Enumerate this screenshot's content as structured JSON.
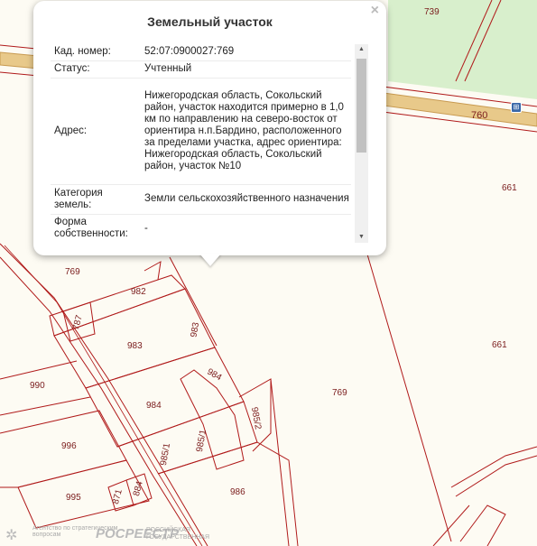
{
  "popup": {
    "title": "Земельный участок",
    "close_symbol": "×",
    "rows": [
      {
        "key": "Кад. номер:",
        "value": "52:07:0900027:769"
      },
      {
        "key": "Статус:",
        "value": "Учтенный"
      },
      {
        "key": "Адрес:",
        "value": "Нижегородская область, Сокольский район, участок находится примерно в 1,0 км по направлению на северо-восток от ориентира н.п.Бардино, расположенного за пределами участка, адрес ориентира: Нижегородская область, Сокольский район, участок №10"
      },
      {
        "key": "Категория земель:",
        "value": "Земли сельскохозяйственного назначения"
      },
      {
        "key": "Форма собственности:",
        "value": "-"
      }
    ]
  },
  "map": {
    "road_number": "760",
    "parcel_labels": {
      "p739": "739",
      "p661a": "661",
      "p661b": "661",
      "p769a": "769",
      "p769b": "769",
      "p982": "982",
      "p787": "787",
      "p983a": "983",
      "p983b": "983",
      "p990": "990",
      "p984a": "984",
      "p984b": "984",
      "p985_2": "985/2",
      "p985_1a": "985/1",
      "p985_1b": "985/1",
      "p996": "996",
      "p995": "995",
      "p871": "871",
      "p884": "884",
      "p986": "986"
    },
    "colors": {
      "parcel_line": "#b01a1a",
      "road_fill": "#e8c98a",
      "forest": "#d8efcc",
      "background": "#fdfbf3"
    }
  },
  "footer": {
    "agency_text": "Агентство по стратегическим",
    "agency_text2": "вопросам",
    "rosreestr_logo": "РОСРЕЕСТР",
    "rosreestr_text": "РОССИЙСКАЯ",
    "rosreestr_text2": "ГОСУДАРСТВЕННАЯ"
  }
}
